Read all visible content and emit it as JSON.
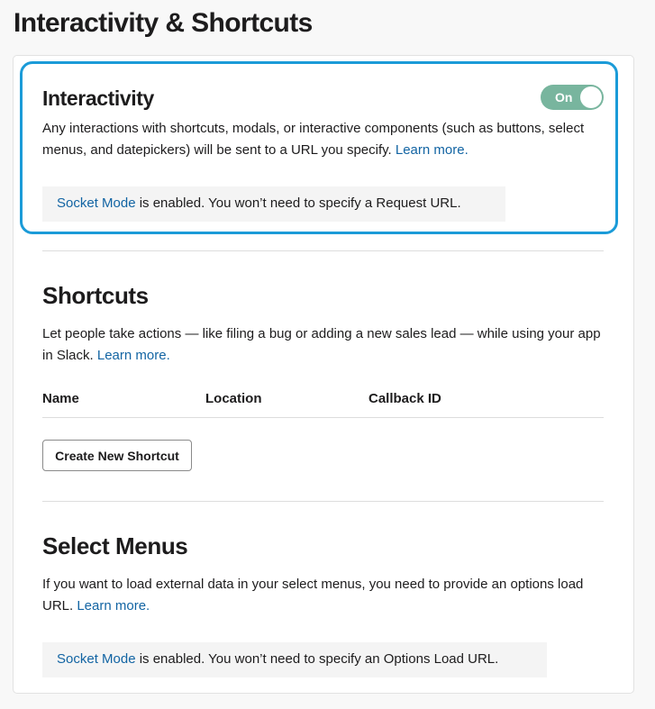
{
  "page": {
    "title": "Interactivity & Shortcuts"
  },
  "interactivity": {
    "heading": "Interactivity",
    "toggle_label": "On",
    "description": "Any interactions with shortcuts, modals, or interactive components (such as buttons, select menus, and datepickers) will be sent to a URL you specify. ",
    "learn_more": "Learn more.",
    "notice_link": "Socket Mode",
    "notice_text": " is enabled. You won’t need to specify a Request URL."
  },
  "shortcuts": {
    "heading": "Shortcuts",
    "description": "Let people take actions — like filing a bug or adding a new sales lead — while using your app in Slack. ",
    "learn_more": "Learn more.",
    "columns": [
      "Name",
      "Location",
      "Callback ID"
    ],
    "create_button": "Create New Shortcut"
  },
  "select_menus": {
    "heading": "Select Menus",
    "description": "If you want to load external data in your select menus, you need to provide an options load URL. ",
    "learn_more": "Learn more.",
    "notice_link": "Socket Mode",
    "notice_text": " is enabled. You won’t need to specify an Options Load URL."
  },
  "colors": {
    "highlight": "#1b9bd8",
    "toggle_on": "#78b59e",
    "link": "#1264a3"
  }
}
